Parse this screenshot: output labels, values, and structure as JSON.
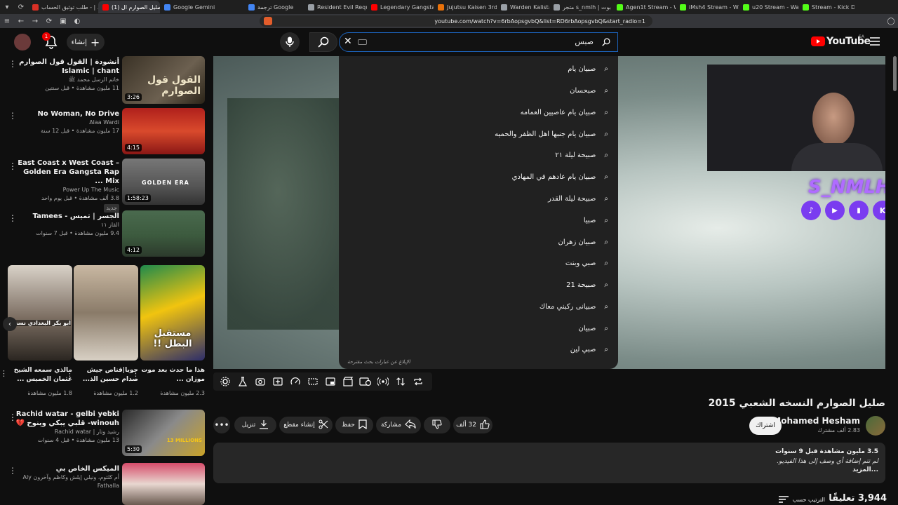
{
  "browser": {
    "tabs": [
      {
        "label": "طلب توثيق الحساب - | ...",
        "color": "#d93025",
        "active": false
      },
      {
        "label": "(1) صليل الصوارم ال...",
        "color": "#ff0000",
        "active": true
      },
      {
        "label": "Google Gemini",
        "color": "#4285f4",
        "active": false
      },
      {
        "label": "ترجمة Google",
        "color": "#4285f4",
        "active": false
      },
      {
        "label": "Resident Evil Requiem",
        "color": "#9aa0a6",
        "active": false
      },
      {
        "label": "Legendary Gangsta Rap",
        "color": "#ff0000",
        "active": false
      },
      {
        "label": "Jujutsu Kaisen 3rd Seasons انمي",
        "color": "#e8710a",
        "active": false
      },
      {
        "label": "Warden Kalista TFT Com",
        "color": "#9aa0a6",
        "active": false
      },
      {
        "label": "متجر s_nmlh | أفضل بوت",
        "color": "#9aa0a6",
        "active": false
      },
      {
        "label": "Agen1t Stream - Watch",
        "color": "#53fc18",
        "active": false
      },
      {
        "label": "iMsh4 Stream - Watc",
        "color": "#53fc18",
        "active": false
      },
      {
        "label": "u20 Stream - Watch",
        "color": "#53fc18",
        "active": false
      },
      {
        "label": "Stream - Kick Dashb",
        "color": "#53fc18",
        "active": false
      }
    ],
    "url": "youtube.com/watch?v=6rbAopsgvbQ&list=RD6rbAopsgvbQ&start_radio=1"
  },
  "header": {
    "logo_text": "YouTube",
    "region": "SA",
    "search_value": "صبس",
    "create_label": "إنشاء",
    "notif_count": "1"
  },
  "suggestions": [
    "صبيان يام",
    "صبحسان",
    "صبيان يام عاصيين العمامه",
    "صبيان يام جنبها اهل الظفر والحميه",
    "صبيحة ليلة ٢١",
    "صبيان يام عادهم في المهادي",
    "صبيحة ليلة القدر",
    "صبيا",
    "صبيان زهران",
    "صبي وبنت",
    "صبيحة 21",
    "صبيانى ركبني معاك",
    "صبيان",
    "صبي لين"
  ],
  "report_text": "الإبلاغ عن عبارات بحث مقترحة",
  "overlay": {
    "brand": "S_NMLH"
  },
  "video": {
    "title": "صليل الصوارم النسخه الشعبي 2015",
    "channel": "Mohamed Hesham",
    "subs": "2.83 ألف مشترك",
    "subscribe": "اشتراك",
    "likes": "32 ألف",
    "share": "مشاركة",
    "save": "حفظ",
    "clip": "إنشاء مقطع",
    "download": "تنزيل",
    "views": "3.5 مليون مشاهدة  قبل 9 سنوات",
    "desc": "لم تتم إضافة أي وصف إلى هذا الفيديو.",
    "more": "...المزيد",
    "comments": "3,944 تعليقًا",
    "sort": "الترتيب حسب"
  },
  "related": [
    {
      "title": "أنشودة | القول قول الصوارم Islamic | chant",
      "channel": "خاتم الرسل محمد ﷺ",
      "views": "11 مليون مشاهدة • قبل سنتين",
      "duration": "3:26",
      "thumb_text": "القول قول الصوارم"
    },
    {
      "title": "No Woman, No Drive",
      "channel": "Alaa Wardi",
      "views": "17 مليون مشاهدة • قبل 12 سنة",
      "duration": "4:15",
      "thumb_text": ""
    },
    {
      "title": "East Coast x West Coast – Golden Era Gangsta Rap Mix ...",
      "channel": "Power Up The Music",
      "views": "3.8 ألف مشاهدة • قبل يوم واحد",
      "badge": "جديد",
      "duration": "1:58:23",
      "thumb_text": "GOLDEN ERA"
    },
    {
      "title": "الجسر | تميس - Tamees",
      "channel": "القاز ١١",
      "views": "9.4 مليون مشاهدة • قبل 7 سنوات",
      "duration": "4:12",
      "thumb_text": ""
    },
    {
      "title": "Rachid watar - gelbi yebki winouh- قلبي يبكي وينوح 💔",
      "channel": "رشيد وتار | Rachid watar",
      "views": "13 مليون مشاهدة • قبل 4 سنوات",
      "duration": "5:30",
      "thumb_text": "13 MILLIONS"
    },
    {
      "title": "الميكس الخاص بي",
      "channel": "أم كلثوم، ونيلي إيلش وكاظم وآخرون Aly Fathalla",
      "views": "",
      "duration": "",
      "thumb_text": ""
    }
  ],
  "shorts": [
    {
      "title": "هذا ما حدث بعد موت موزان ...",
      "views": "2.3 مليون مشاهدة",
      "text": "مستقبل البطل !!"
    },
    {
      "title": "جوبا|قناص جيش صدام حسين الذ...",
      "views": "1.2 مليون مشاهدة",
      "text": ""
    },
    {
      "title": "مالذي سمعه الشيخ عثمان الخميس ...",
      "views": "1.8 مليون مشاهدة",
      "text": "ابو بكر البغدادي نسب"
    }
  ],
  "colors": {
    "accent": "#1c62b9",
    "brand_red": "#ff0000",
    "twitch": "#9146ff"
  }
}
